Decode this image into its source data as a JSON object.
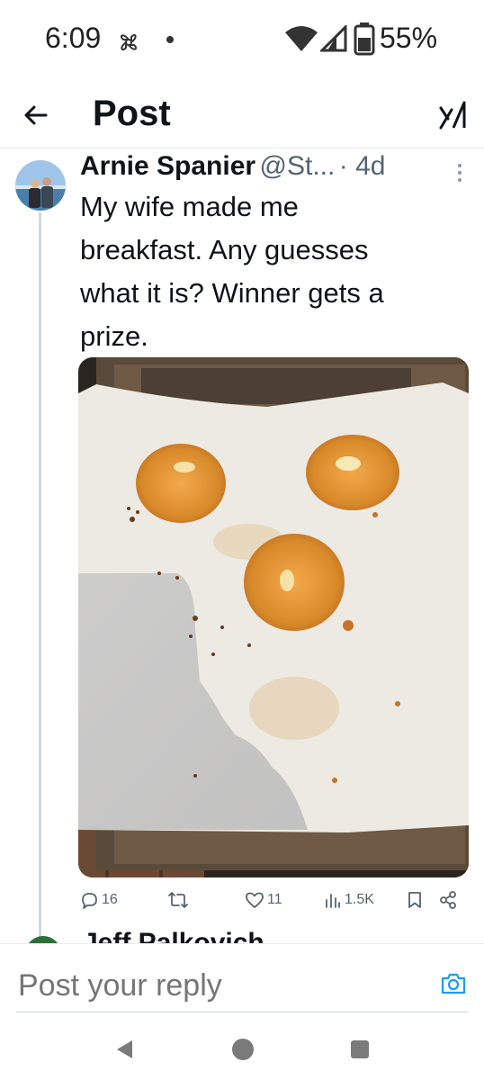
{
  "status_bar": {
    "time": "6:09",
    "battery": "55%"
  },
  "header": {
    "title": "Post"
  },
  "tweet": {
    "author_name": "Arnie Spanier",
    "author_handle": "@St...",
    "time_sep": " · ",
    "time": "4d",
    "text_lines": [
      "My wife made me",
      "breakfast.  Any guesses",
      "what it is? Winner gets a",
      "prize."
    ],
    "stats": {
      "replies": "16",
      "likes": "11",
      "views": "1.5K"
    }
  },
  "next_reply": {
    "author_name": "Jeff Palkovich"
  },
  "reply": {
    "placeholder": "Post your reply"
  },
  "colors": {
    "text": "#0f1419",
    "muted": "#536471",
    "accent": "#1d9bf0",
    "divider": "#e6ecf0"
  }
}
